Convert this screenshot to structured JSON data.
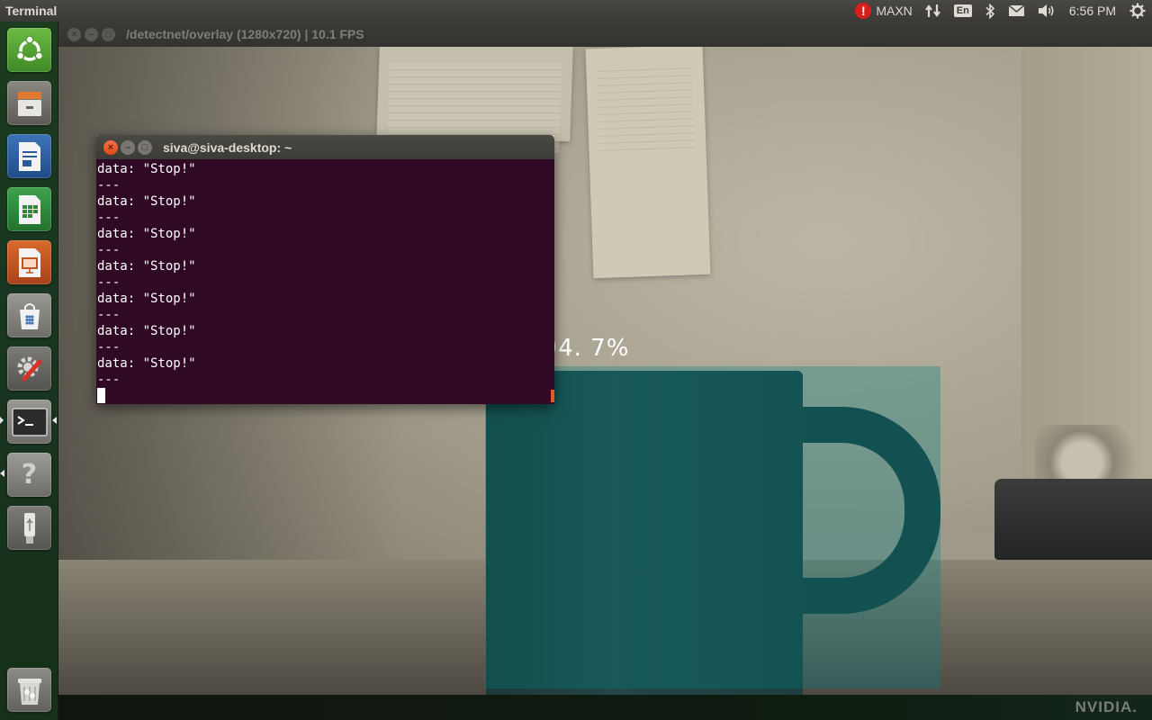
{
  "top_panel": {
    "app_title": "Terminal",
    "power_mode": "MAXN",
    "keyboard_layout": "En",
    "clock": "6:56 PM",
    "icons": [
      "warning-icon",
      "network-arrows-icon",
      "keyboard-icon",
      "bluetooth-icon",
      "mail-icon",
      "volume-icon",
      "settings-gear-icon"
    ]
  },
  "launcher": {
    "items": [
      {
        "name": "ubuntu-dash",
        "icon": "ubuntu-logo-icon",
        "color": "#58a33a"
      },
      {
        "name": "files",
        "icon": "file-cabinet-icon",
        "color": "#6d6a63"
      },
      {
        "name": "libreoffice-writer",
        "icon": "writer-doc-icon",
        "color": "#2a5a9a"
      },
      {
        "name": "libreoffice-calc",
        "icon": "calc-sheet-icon",
        "color": "#2d8a3a"
      },
      {
        "name": "libreoffice-impress",
        "icon": "impress-slide-icon",
        "color": "#c2551f"
      },
      {
        "name": "software-center",
        "icon": "shopping-bag-icon",
        "color": "#4a7ab5"
      },
      {
        "name": "system-settings",
        "icon": "wrench-gear-icon",
        "color": "#6e6b66"
      },
      {
        "name": "terminal",
        "icon": "terminal-icon",
        "color": "#2f2f2f"
      },
      {
        "name": "help",
        "icon": "question-mark-icon",
        "color": "#7a7a7a"
      },
      {
        "name": "usb-drive",
        "icon": "usb-icon",
        "color": "#6e6e6e"
      },
      {
        "name": "trash",
        "icon": "trash-icon",
        "color": "#7a7a7a"
      }
    ]
  },
  "video_window": {
    "title": "/detectnet/overlay (1280x720) | 10.1 FPS",
    "detection": {
      "label": "cup 94. 7%",
      "class": "cup",
      "confidence_percent": 94.7,
      "color": "#008080"
    },
    "watermark": "NVIDIA."
  },
  "terminal": {
    "title": "siva@siva-desktop: ~",
    "lines": [
      "data: \"Stop!\"",
      "---",
      "data: \"Stop!\"",
      "---",
      "data: \"Stop!\"",
      "---",
      "data: \"Stop!\"",
      "---",
      "data: \"Stop!\"",
      "---",
      "data: \"Stop!\"",
      "---",
      "data: \"Stop!\"",
      "---"
    ]
  }
}
